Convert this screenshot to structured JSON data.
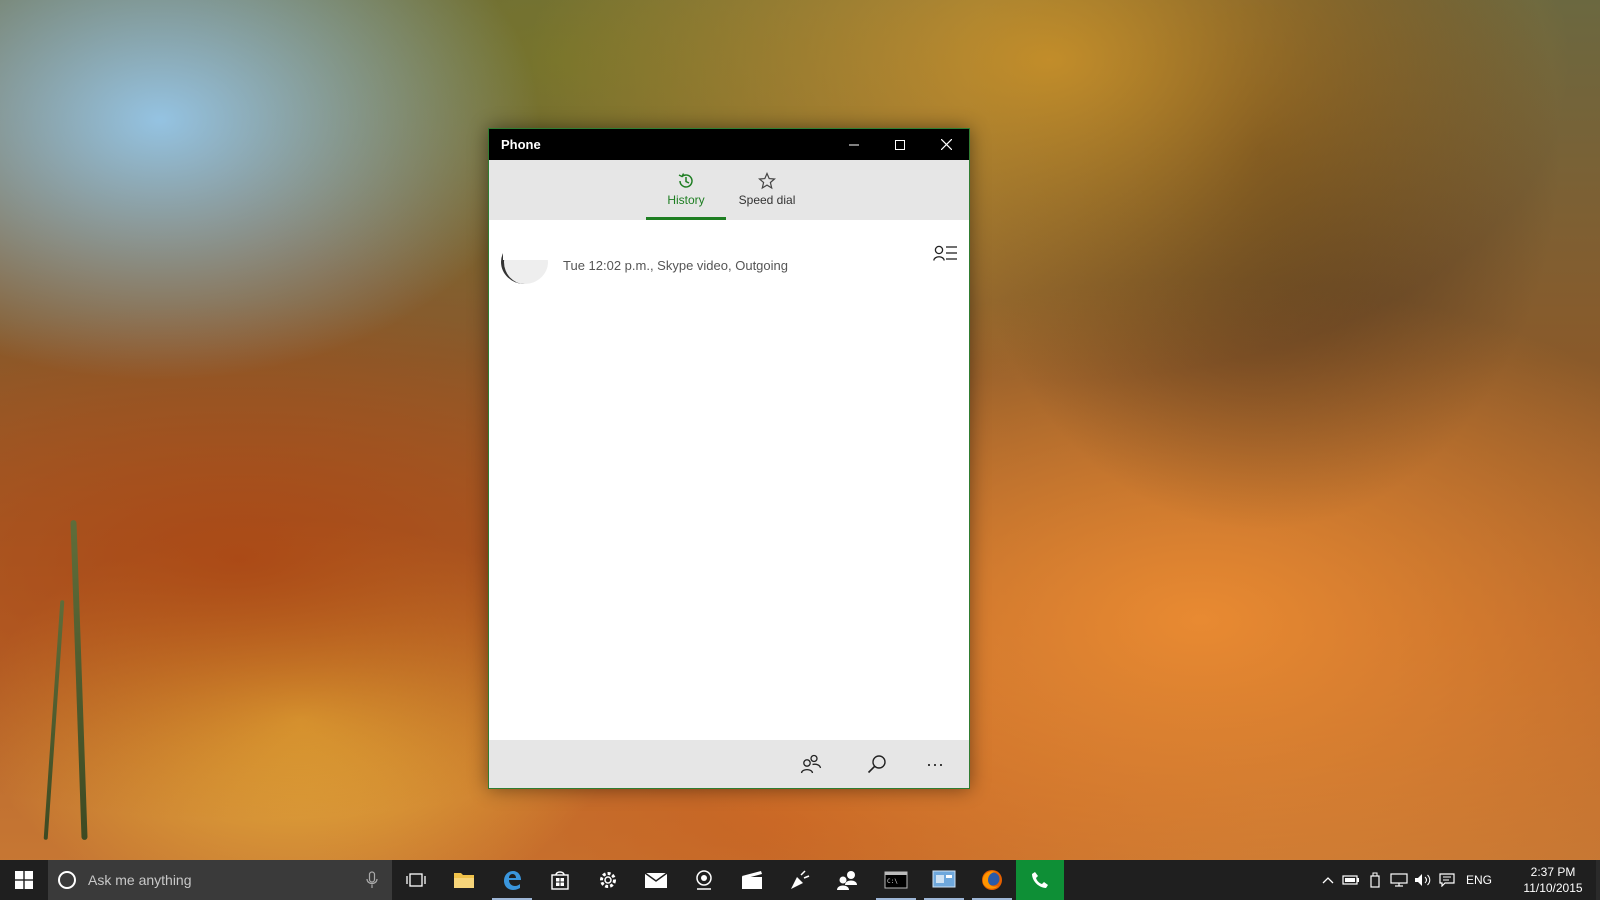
{
  "window": {
    "title": "Phone",
    "accent_color": "#1e7e22",
    "controls": {
      "minimize": "—",
      "maximize": "☐",
      "close": "✕"
    }
  },
  "tabs": [
    {
      "label": "History",
      "icon": "history-icon",
      "active": true
    },
    {
      "label": "Speed dial",
      "icon": "star-icon",
      "active": false
    }
  ],
  "history": {
    "items": [
      {
        "detail": "Tue 12:02 p.m., Skype video, Outgoing",
        "icon": "contact-card-icon"
      }
    ]
  },
  "appbar": {
    "buttons": [
      "contacts-icon",
      "search-icon",
      "more-icon"
    ],
    "more_label": "···"
  },
  "taskbar": {
    "search_placeholder": "Ask me anything",
    "apps": [
      "task-view-icon",
      "file-explorer-icon",
      "edge-icon",
      "store-icon",
      "settings-icon",
      "mail-icon",
      "camera-icon",
      "movies-icon",
      "get-started-icon",
      "people-icon",
      "command-prompt-icon",
      "control-panel-icon",
      "firefox-icon",
      "phone-icon"
    ],
    "language": "ENG",
    "time": "2:37 PM",
    "date": "11/10/2015"
  }
}
